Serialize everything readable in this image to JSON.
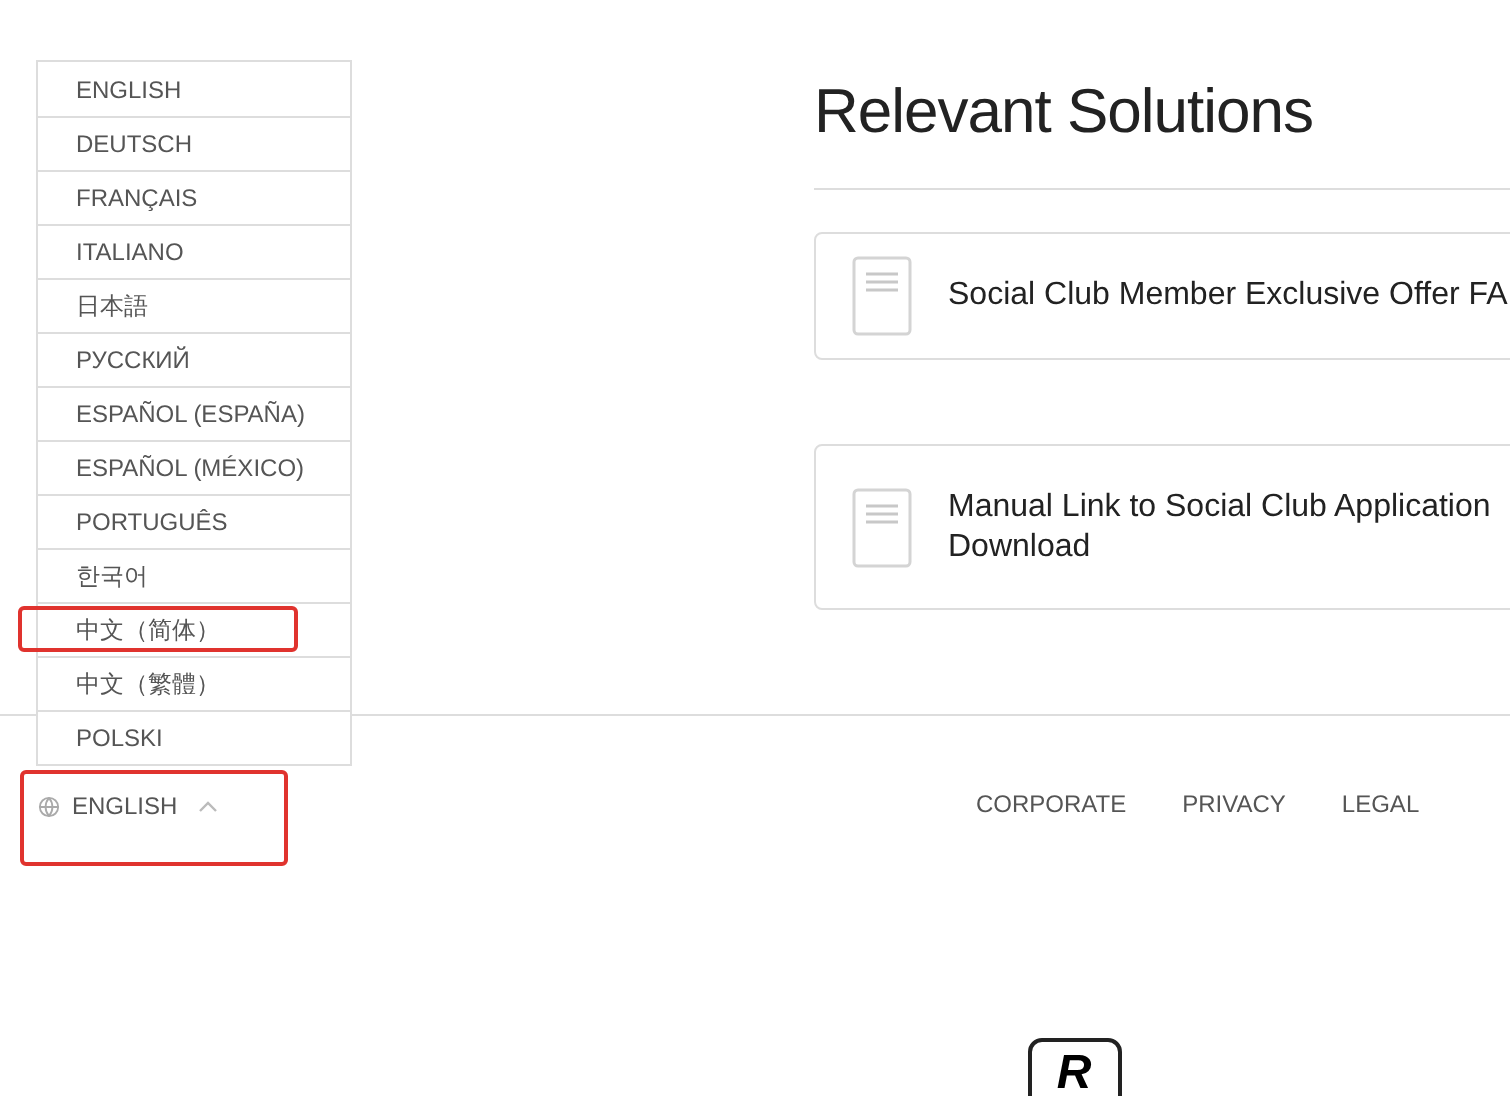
{
  "title": "Relevant Solutions",
  "articles": [
    {
      "title": "Social Club Member Exclusive Offer FA"
    },
    {
      "title": "Manual Link to Social Club Application Download"
    }
  ],
  "languages": [
    {
      "label": "ENGLISH",
      "highlighted": false
    },
    {
      "label": "DEUTSCH",
      "highlighted": false
    },
    {
      "label": "FRANÇAIS",
      "highlighted": false
    },
    {
      "label": "ITALIANO",
      "highlighted": false
    },
    {
      "label": "日本語",
      "highlighted": false
    },
    {
      "label": "РУССКИЙ",
      "highlighted": false
    },
    {
      "label": "ESPAÑOL (ESPAÑA)",
      "highlighted": false
    },
    {
      "label": "ESPAÑOL (MÉXICO)",
      "highlighted": false
    },
    {
      "label": "PORTUGUÊS",
      "highlighted": false
    },
    {
      "label": "한국어",
      "highlighted": false
    },
    {
      "label": "中文（简体）",
      "highlighted": true
    },
    {
      "label": "中文（繁體）",
      "highlighted": false
    },
    {
      "label": "POLSKI",
      "highlighted": false
    }
  ],
  "language_selector": {
    "label": "ENGLISH",
    "expanded": true,
    "highlighted": true
  },
  "footer_links": [
    "CORPORATE",
    "PRIVACY",
    "LEGAL"
  ],
  "logo": {
    "letter": "R"
  }
}
